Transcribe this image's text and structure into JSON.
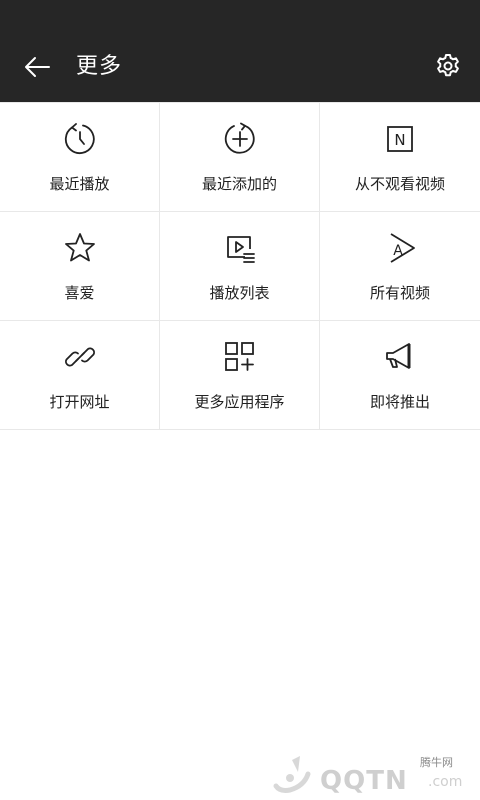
{
  "header": {
    "title": "更多"
  },
  "colors": {
    "header_bg": "#262626",
    "icon_stroke": "#222222",
    "divider": "#e8e8e8"
  },
  "grid": {
    "items": [
      {
        "label": "最近播放",
        "icon": "recent-play-icon"
      },
      {
        "label": "最近添加的",
        "icon": "recent-add-icon"
      },
      {
        "label": "从不观看视频",
        "icon": "never-watched-icon"
      },
      {
        "label": "喜爱",
        "icon": "star-icon"
      },
      {
        "label": "播放列表",
        "icon": "playlist-icon"
      },
      {
        "label": "所有视频",
        "icon": "all-videos-icon"
      },
      {
        "label": "打开网址",
        "icon": "link-icon"
      },
      {
        "label": "更多应用程序",
        "icon": "apps-grid-icon"
      },
      {
        "label": "即将推出",
        "icon": "megaphone-icon"
      }
    ]
  },
  "watermark": {
    "small": "腾牛网",
    "big": "QQTN",
    "suffix": ".com"
  }
}
